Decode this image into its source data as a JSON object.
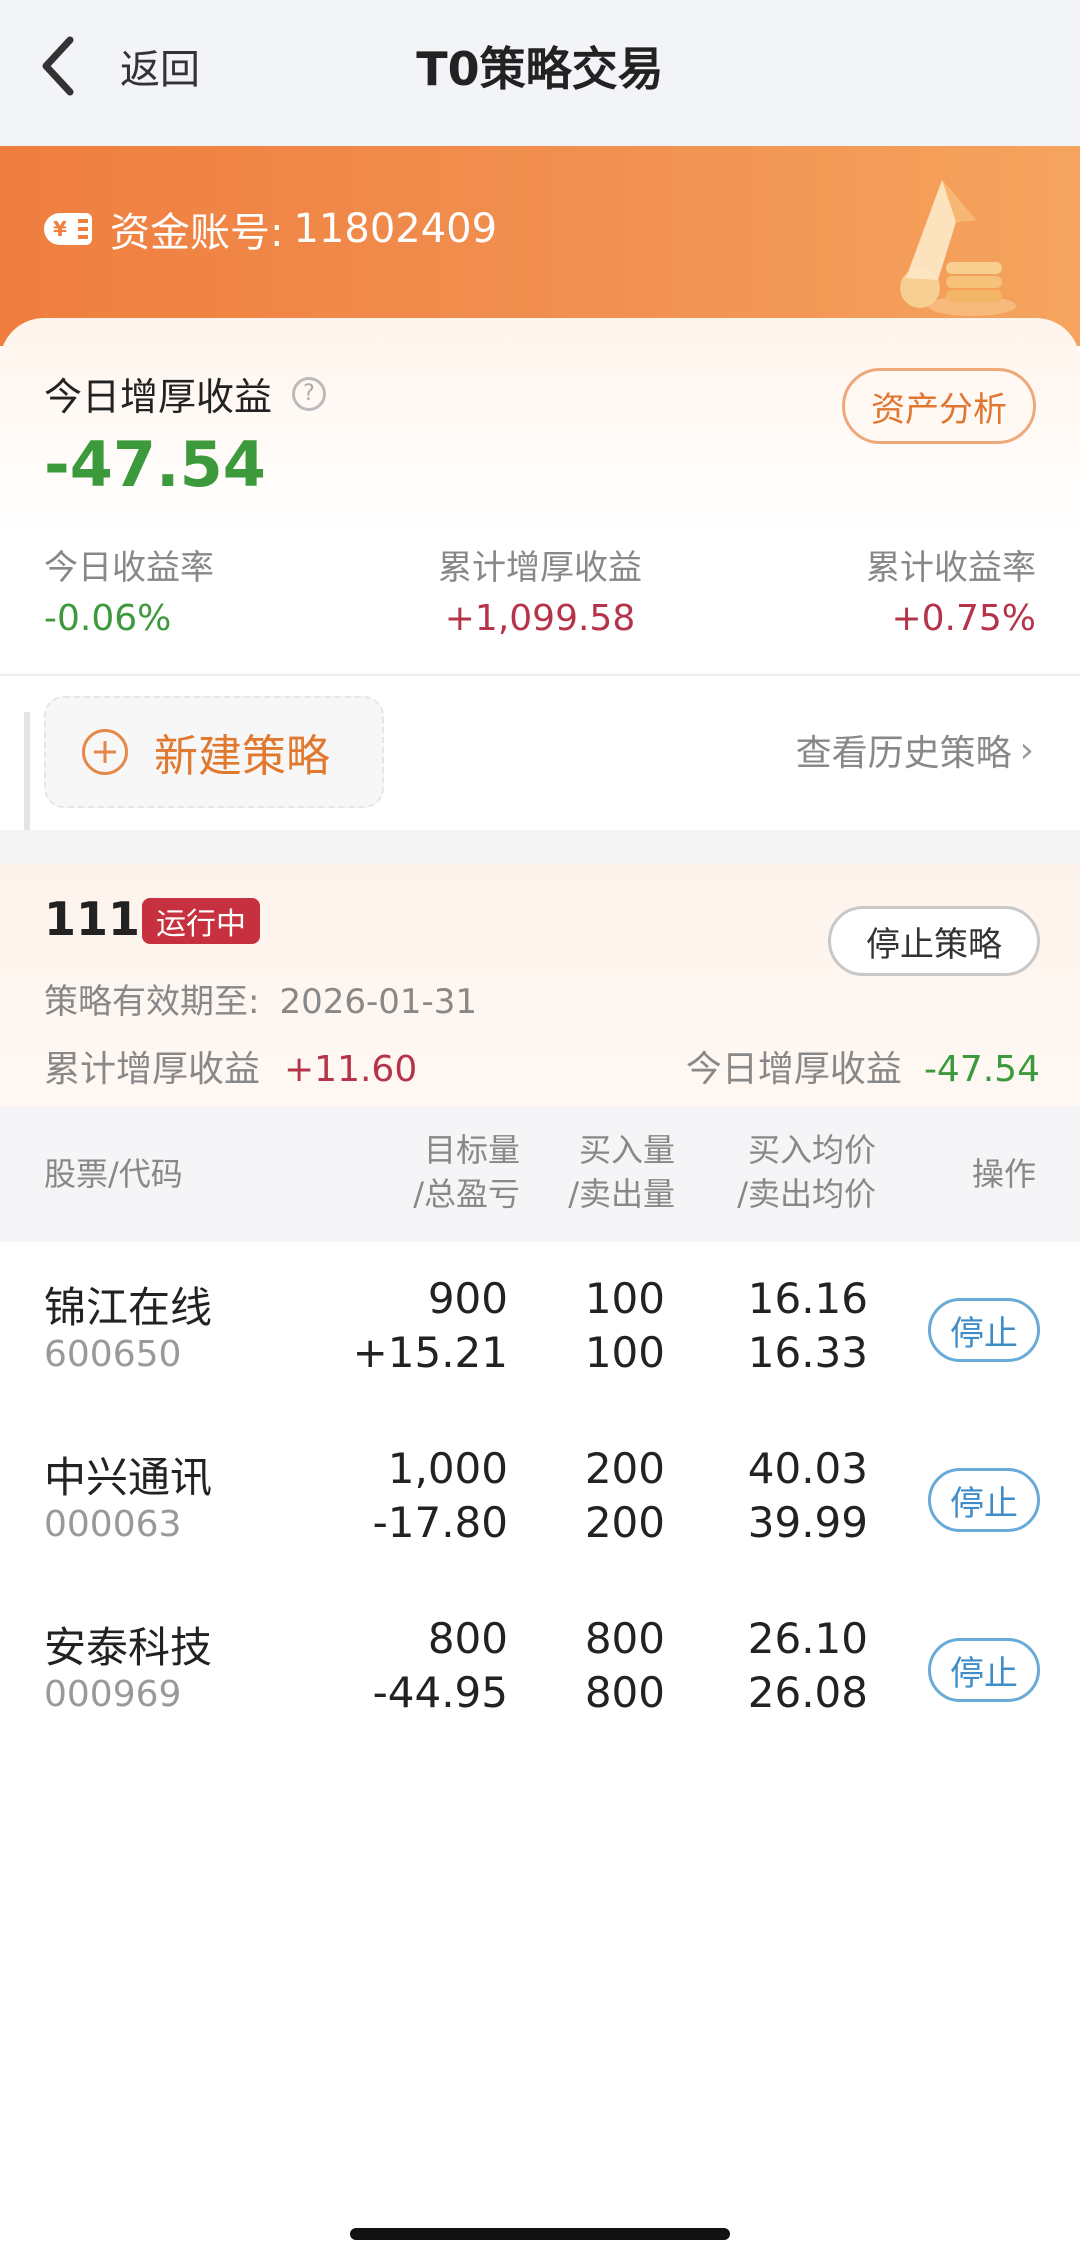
{
  "nav": {
    "back_label": "返回",
    "title": "T0策略交易"
  },
  "account": {
    "label": "资金账号:",
    "number": "11802409"
  },
  "summary": {
    "title": "今日增厚收益",
    "help": "?",
    "value": "-47.54",
    "analysis_button": "资产分析",
    "stats": [
      {
        "label": "今日收益率",
        "value": "-0.06%"
      },
      {
        "label": "累计增厚收益",
        "value": "+1,099.58"
      },
      {
        "label": "累计收益率",
        "value": "+0.75%"
      }
    ]
  },
  "actions": {
    "new_strategy": "新建策略",
    "history": "查看历史策略",
    "history_chevron": "›"
  },
  "strategy": {
    "name": "111",
    "status": "运行中",
    "stop_button": "停止策略",
    "valid_label": "策略有效期至:",
    "valid_date": "2026-01-31",
    "accum_label": "累计增厚收益",
    "accum_value": "+11.60",
    "today_label": "今日增厚收益",
    "today_value": "-47.54"
  },
  "table": {
    "headers": {
      "stock": "股票/代码",
      "target_1": "目标量",
      "target_2": "/总盈亏",
      "buy_1": "买入量",
      "buy_2": "/卖出量",
      "price_1": "买入均价",
      "price_2": "/卖出均价",
      "op": "操作"
    },
    "rows": [
      {
        "name": "锦江在线",
        "code": "600650",
        "target": "900",
        "pnl": "+15.21",
        "buy_qty": "100",
        "sell_qty": "100",
        "buy_price": "16.16",
        "sell_price": "16.33",
        "action": "停止"
      },
      {
        "name": "中兴通讯",
        "code": "000063",
        "target": "1,000",
        "pnl": "-17.80",
        "buy_qty": "200",
        "sell_qty": "200",
        "buy_price": "40.03",
        "sell_price": "39.99",
        "action": "停止"
      },
      {
        "name": "安泰科技",
        "code": "000969",
        "target": "800",
        "pnl": "-44.95",
        "buy_qty": "800",
        "sell_qty": "800",
        "buy_price": "26.10",
        "sell_price": "26.08",
        "action": "停止"
      }
    ]
  },
  "colors": {
    "accent_orange": "#ef7e3f",
    "gain_red": "#b5344a",
    "loss_green": "#3c9a3c",
    "link_blue": "#3f8dc8"
  }
}
